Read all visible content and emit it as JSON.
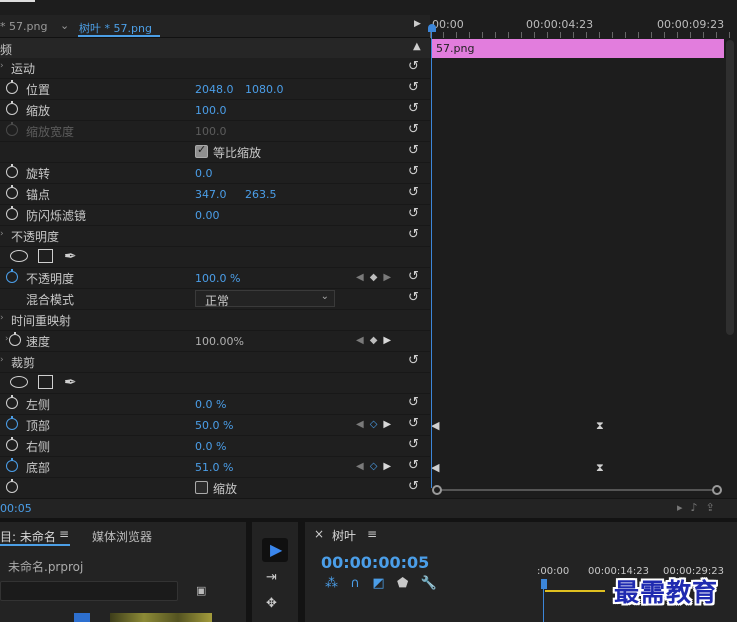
{
  "tabs": {
    "source_tab": "* 57.png",
    "arrow": "⌄",
    "active_tab": "树叶 * 57.png"
  },
  "header": {
    "label": "频",
    "collapse_icon": "▲"
  },
  "timeline": {
    "timecodes": [
      "00:00",
      "00:00:04:23",
      "00:00:09:23"
    ],
    "play_icon": "▶",
    "clip_name": "57.png"
  },
  "rows": {
    "motion": "运动",
    "position": {
      "label": "位置",
      "x": "2048.0",
      "y": "1080.0"
    },
    "scale": {
      "label": "缩放",
      "value": "100.0"
    },
    "scale_width": {
      "label": "缩放宽度",
      "value": "100.0"
    },
    "uniform_scale": {
      "label": "等比缩放"
    },
    "rotation": {
      "label": "旋转",
      "value": "0.0"
    },
    "anchor": {
      "label": "锚点",
      "x": "347.0",
      "y": "263.5"
    },
    "anti_flicker": {
      "label": "防闪烁滤镜",
      "value": "0.00"
    },
    "opacity_section": "不透明度",
    "opacity": {
      "label": "不透明度",
      "value": "100.0 %"
    },
    "blend_mode": {
      "label": "混合模式",
      "value": "正常"
    },
    "time_remap": "时间重映射",
    "speed": {
      "label": "速度",
      "value": "100.00%"
    },
    "crop_section": "裁剪",
    "left": {
      "label": "左侧",
      "value": "0.0 %"
    },
    "top": {
      "label": "顶部",
      "value": "50.0 %"
    },
    "right": {
      "label": "右侧",
      "value": "0.0 %"
    },
    "bottom": {
      "label": "底部",
      "value": "51.0 %"
    },
    "zoom": {
      "label": "缩放"
    }
  },
  "footer": {
    "time": "00:05"
  },
  "project": {
    "tab": "目: 未命名",
    "menu": "≡",
    "media_tab": "媒体浏览器",
    "file": "未命名.prproj"
  },
  "sequence": {
    "tab": "树叶",
    "menu": "≡",
    "close": "×",
    "timecode": "00:00:00:05",
    "ruler": [
      ":00:00",
      "00:00:14:23",
      "00:00:29:23"
    ]
  },
  "watermark": "最需教育",
  "colors": {
    "accent": "#4b9ee8",
    "clip": "#e27ddd"
  }
}
